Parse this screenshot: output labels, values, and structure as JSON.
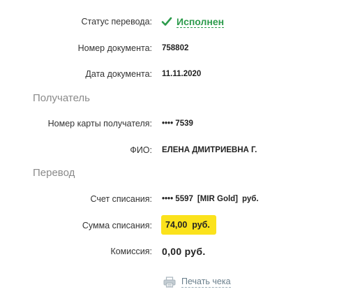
{
  "transfer_details": {
    "status": {
      "label": "Статус перевода:",
      "value": "Исполнен"
    },
    "document_number": {
      "label": "Номер документа:",
      "value": "758802"
    },
    "document_date": {
      "label": "Дата документа:",
      "value": "11.11.2020"
    }
  },
  "recipient": {
    "section_title": "Получатель",
    "card": {
      "label": "Номер карты получателя:",
      "value": "•••• 7539"
    },
    "name": {
      "label": "ФИО:",
      "value": "ЕЛЕНА ДМИТРИЕВНА Г."
    }
  },
  "transfer": {
    "section_title": "Перевод",
    "debit_account": {
      "label": "Счет списания:",
      "card_mask": "•••• 5597",
      "card_type": "[MIR Gold]",
      "currency": "руб."
    },
    "debit_amount": {
      "label": "Сумма списания:",
      "value": "74,00  руб."
    },
    "fee": {
      "label": "Комиссия:",
      "value": "0,00 руб."
    }
  },
  "actions": {
    "print_receipt": "Печать чека"
  },
  "colors": {
    "status_green": "#2c9b4b",
    "highlight_yellow": "#fbe21c",
    "section_gray": "#8a8a8a",
    "link_gray": "#6a7f8c"
  },
  "icons": {
    "status": "check-icon",
    "print": "printer-icon"
  }
}
